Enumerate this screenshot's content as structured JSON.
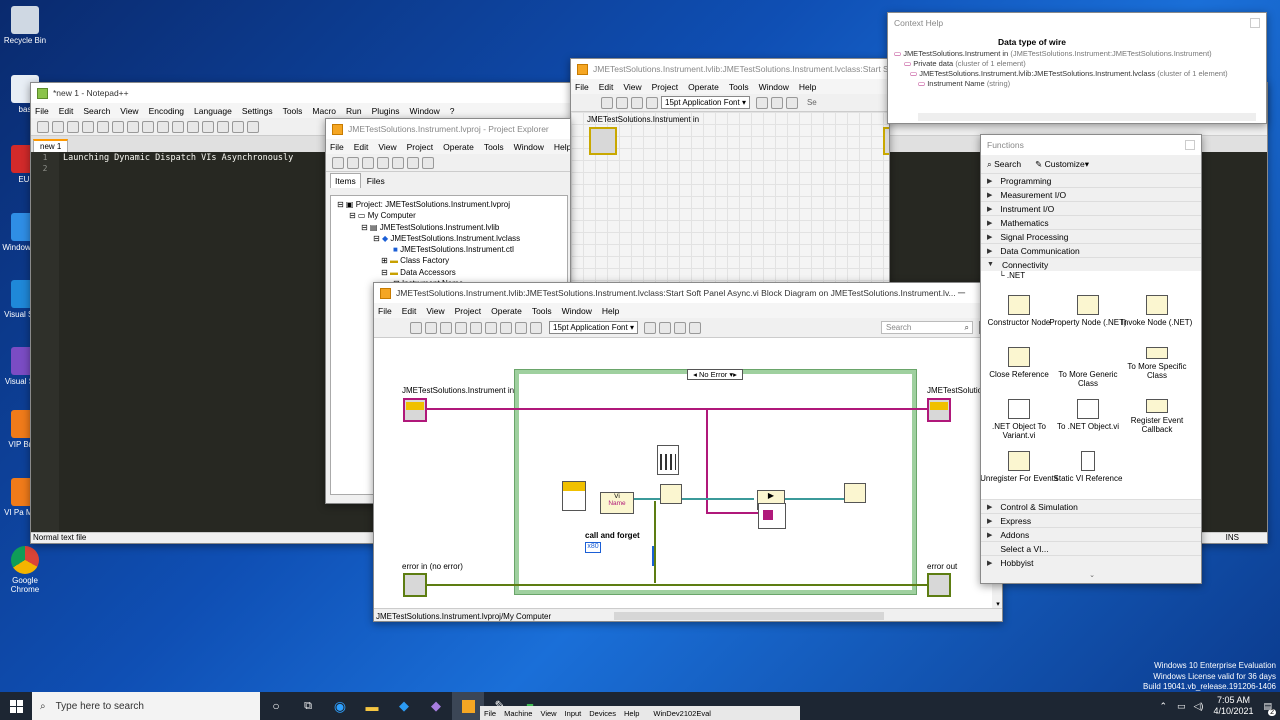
{
  "desktop": {
    "icons": [
      {
        "label": "Recycle Bin"
      },
      {
        "label": "bas"
      },
      {
        "label": "EUI"
      },
      {
        "label": "Window Cen"
      },
      {
        "label": "Visual S Co"
      },
      {
        "label": "Visual S 20"
      },
      {
        "label": "VIP Brow"
      },
      {
        "label": "VI Pa Mana"
      },
      {
        "label": "Google Chrome"
      }
    ],
    "watermark": {
      "line1": "Windows 10 Enterprise Evaluation",
      "line2": "Windows License valid for 36 days",
      "line3": "Build 19041.vb_release.191206-1406"
    }
  },
  "notepad": {
    "title": "*new 1 - Notepad++",
    "menu": [
      "File",
      "Edit",
      "Search",
      "View",
      "Encoding",
      "Language",
      "Settings",
      "Tools",
      "Macro",
      "Run",
      "Plugins",
      "Window",
      "?"
    ],
    "tab": "new 1",
    "lines": [
      {
        "num": "1",
        "text": "Launching Dynamic Dispatch VIs Asynchronously"
      },
      {
        "num": "2",
        "text": ""
      }
    ],
    "status": "Normal text file",
    "status_right": "INS"
  },
  "project_explorer": {
    "title": "JMETestSolutions.Instrument.lvproj - Project Explorer",
    "menu": [
      "File",
      "Edit",
      "View",
      "Project",
      "Operate",
      "Tools",
      "Window",
      "Help"
    ],
    "tabs": [
      "Items",
      "Files"
    ],
    "tree": [
      {
        "text": "Project: JMETestSolutions.Instrument.lvproj"
      },
      {
        "text": "My Computer"
      },
      {
        "text": "JMETestSolutions.Instrument.lvlib"
      },
      {
        "text": "JMETestSolutions.Instrument.lvclass"
      },
      {
        "text": "JMETestSolutions.Instrument.ctl"
      },
      {
        "text": "Class Factory"
      },
      {
        "text": "Data Accessors"
      },
      {
        "text": "Instrument Name"
      }
    ]
  },
  "front_window": {
    "title": "JMETestSolutions.Instrument.lvlib:JMETestSolutions.Instrument.lvclass:Start Soft Panel Async.vi",
    "menu": [
      "File",
      "Edit",
      "View",
      "Project",
      "Operate",
      "Tools",
      "Window",
      "Help"
    ],
    "font": "15pt Application Font",
    "search": "Se",
    "terminal_label": "JMETestSolutions.Instrument in"
  },
  "context_help": {
    "title": "Context Help",
    "heading": "Data type of wire",
    "lines": [
      {
        "label": "JMETestSolutions.Instrument in",
        "detail": "(JMETestSolutions.Instrument:JMETestSolutions.Instrument)"
      },
      {
        "label": "Private data",
        "detail": "(cluster of 1 element)"
      },
      {
        "label": "JMETestSolutions.Instrument.lvlib:JMETestSolutions.Instrument.lvclass",
        "detail": "(cluster of 1 element)"
      },
      {
        "label": "Instrument Name",
        "detail": "(string)"
      }
    ]
  },
  "block_diagram": {
    "title": "JMETestSolutions.Instrument.lvlib:JMETestSolutions.Instrument.lvclass:Start Soft Panel Async.vi Block Diagram on JMETestSolutions.Instrument.lv...",
    "menu": [
      "File",
      "Edit",
      "View",
      "Project",
      "Operate",
      "Tools",
      "Window",
      "Help"
    ],
    "font": "15pt Application Font",
    "search_placeholder": "Search",
    "case_selector": "No Error",
    "labels": {
      "instr_in": "JMETestSolutions.Instrument in",
      "instr_out": "JMETestSolutio",
      "error_in": "error in (no error)",
      "error_out": "error out",
      "call_forget": "call and forget",
      "const_value": "x80",
      "name_node": "Name",
      "vi_node": "Vi"
    },
    "status": "JMETestSolutions.Instrument.lvproj/My Computer"
  },
  "functions": {
    "title": "Functions",
    "search": "Search",
    "customize": "Customize",
    "categories_top": [
      "Programming",
      "Measurement I/O",
      "Instrument I/O",
      "Mathematics",
      "Signal Processing",
      "Data Communication"
    ],
    "expanded": "Connectivity",
    "subcategory": ".NET",
    "items": [
      {
        "label": "Constructor Node"
      },
      {
        "label": "Property Node (.NET)"
      },
      {
        "label": "Invoke Node (.NET)"
      },
      {
        "label": "Close Reference"
      },
      {
        "label": "To More Generic Class"
      },
      {
        "label": "To More Specific Class"
      },
      {
        "label": ".NET Object To Variant.vi"
      },
      {
        "label": "To .NET Object.vi"
      },
      {
        "label": "Register Event Callback"
      },
      {
        "label": "Unregister For Events"
      },
      {
        "label": "Static VI Reference"
      }
    ],
    "categories_bottom": [
      "Control & Simulation",
      "Express",
      "Addons",
      "Select a VI...",
      "Hobbyist"
    ]
  },
  "taskbar": {
    "search_placeholder": "Type here to search",
    "vm_menu": [
      "File",
      "Machine",
      "View",
      "Input",
      "Devices",
      "Help"
    ],
    "vm_name": "WinDev2102Eval",
    "time": "7:05 AM",
    "date": "4/10/2021",
    "notifications": "2"
  }
}
